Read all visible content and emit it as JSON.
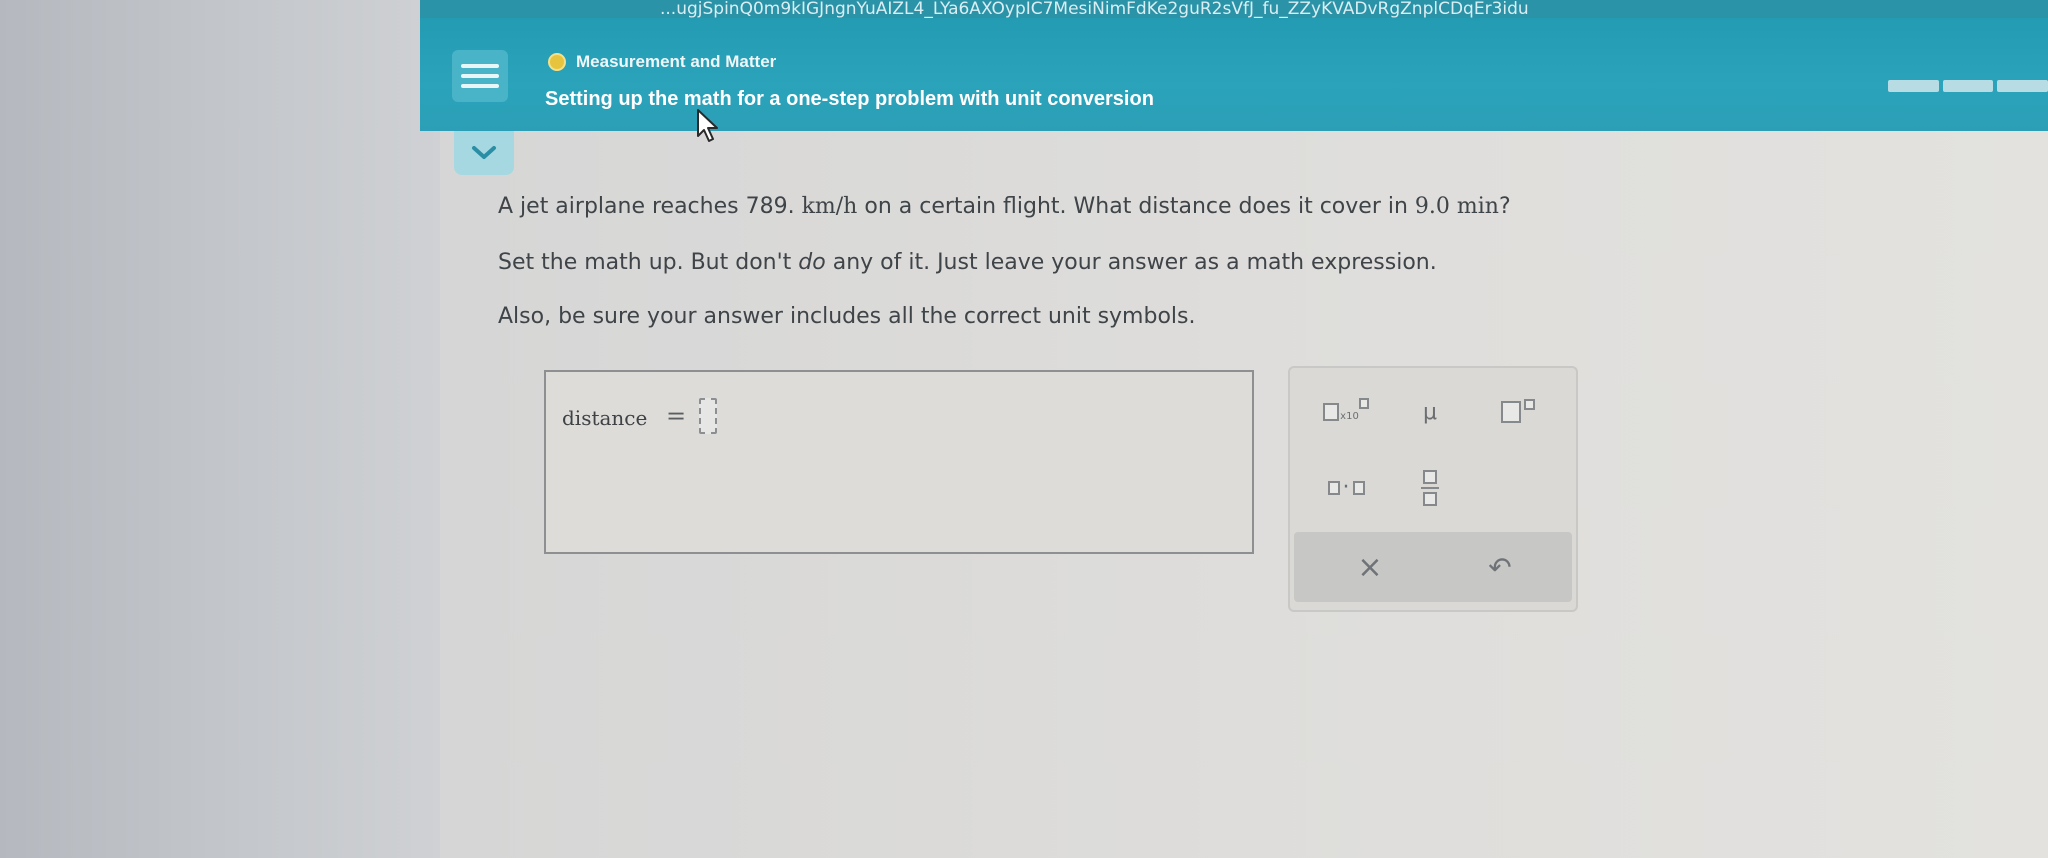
{
  "browser": {
    "url_fragment": "...ugjSpinQ0m9kIGJngnYuAIZL4_LYa6AXOypIC7MesiNimFdKe2guR2sVfJ_fu_ZZyKVADvRgZnplCDqEr3idu"
  },
  "header": {
    "topic": "Measurement and Matter",
    "title": "Setting up the math for a one-step problem with unit conversion",
    "progress_segments": 3
  },
  "question": {
    "line1_a": "A jet airplane reaches 789. ",
    "line1_unit": "km/h",
    "line1_b": " on a certain flight. What distance does it cover in ",
    "line1_time": "9.0 min",
    "line1_end": "?",
    "line2_a": "Set the math up. But don't ",
    "line2_em": "do",
    "line2_b": " any of it. Just leave your answer as a math expression.",
    "line3": "Also, be sure your answer includes all the correct unit symbols."
  },
  "answer": {
    "label": "distance",
    "equals": "="
  },
  "keypad": {
    "sci_notation_label": "x10",
    "mu_label": "μ",
    "multiply_label": "·",
    "clear_label": "×",
    "undo_label": "↶"
  },
  "colors": {
    "header": "#2aa3bb",
    "accent_light": "#a6d8e2",
    "text": "#3f4448"
  }
}
